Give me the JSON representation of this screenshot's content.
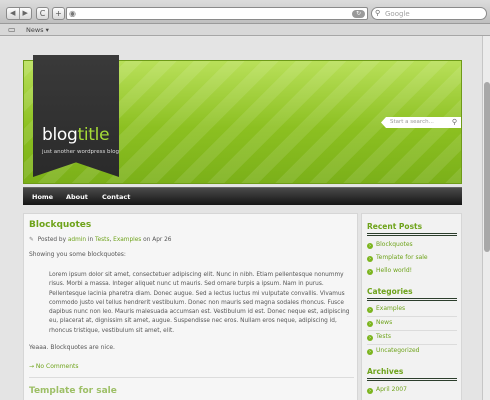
{
  "browser": {
    "back_glyph": "◀",
    "forward_glyph": "▶",
    "refresh_glyph": "C",
    "add_glyph": "+",
    "url_refresh_glyph": "↻",
    "search_placeholder": "Google",
    "search_glyph": "⚲",
    "bookmarks_glyph": "▭",
    "bookmark_news": "News ▾"
  },
  "blog": {
    "title_main": "blog",
    "title_accent": "title",
    "tagline": "just another wordpress blog",
    "search_placeholder": "Start a search...",
    "search_glyph": "⚲"
  },
  "nav": [
    "Home",
    "About",
    "Contact"
  ],
  "post": {
    "title": "Blockquotes",
    "meta_icon": "✎",
    "meta_posted_by": "Posted by",
    "meta_author": "admin",
    "meta_in": "in",
    "meta_cat1": "Tests",
    "meta_cat2": "Examples",
    "meta_on": "on Apr 26",
    "intro": "Showing you some blockquotes:",
    "quote": "Lorem ipsum dolor sit amet, consectetuer adipiscing elit. Nunc in nibh. Etiam pellentesque nonummy risus. Morbi a massa. Integer aliquet nunc ut mauris. Sed ornare turpis a ipsum. Nam in purus. Pellentesque lacinia pharetra diam. Donec augue. Sed a lectus luctus mi vulputate convallis. Vivamus commodo justo vel tellus hendrerit vestibulum. Donec non mauris sed magna sodales rhoncus. Fusce dapibus nunc non leo. Mauris malesuada accumsan est. Vestibulum id est. Donec neque est, adipiscing eu, placerat at, dignissim sit amet, augue. Suspendisse nec eros. Nullam eros neque, adipiscing id, rhoncus tristique, vestibulum sit amet, elit.",
    "outro": "Yeaaa. Blockquotes are nice.",
    "comments": "→ No Comments",
    "next_title": "Template for sale"
  },
  "sidebar": {
    "recent_title": "Recent Posts",
    "recent": [
      "Blockquotes",
      "Template for sale",
      "Hello world!"
    ],
    "categories_title": "Categories",
    "categories": [
      "Examples",
      "News",
      "Tests",
      "Uncategorized"
    ],
    "archives_title": "Archives",
    "archives": [
      "April 2007"
    ],
    "bullet_glyph": "›"
  }
}
